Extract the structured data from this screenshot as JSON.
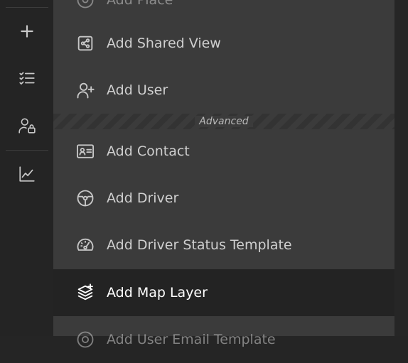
{
  "rail": {
    "buttons": [
      {
        "icon": "plus-icon"
      },
      {
        "icon": "checklist-icon"
      },
      {
        "icon": "user-lock-icon"
      },
      {
        "icon": "chart-line-icon"
      }
    ]
  },
  "menu": {
    "top_partial_label": "Add Place",
    "items": [
      {
        "label": "Add Shared View",
        "icon": "share-square-icon"
      },
      {
        "label": "Add User",
        "icon": "user-plus-icon"
      }
    ],
    "section_label": "Advanced",
    "advanced_items": [
      {
        "label": "Add Contact",
        "icon": "id-card-icon"
      },
      {
        "label": "Add Driver",
        "icon": "steering-wheel-icon"
      },
      {
        "label": "Add Driver Status Template",
        "icon": "gauge-icon"
      },
      {
        "label": "Add Map Layer",
        "icon": "layers-plus-icon",
        "active": true
      }
    ],
    "bottom_partial_label": "Add User Email Template"
  },
  "colors": {
    "rail_bg": "#242424",
    "menu_bg": "#3b3b3b",
    "active_bg": "#232323",
    "text": "#cfcfcf",
    "icon": "#c8c8c8"
  }
}
